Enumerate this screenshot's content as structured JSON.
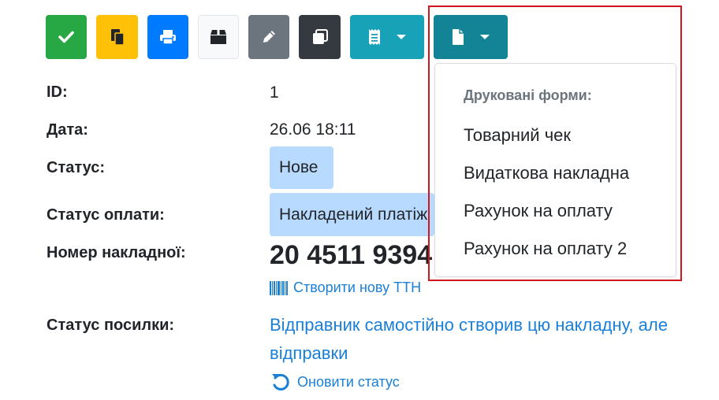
{
  "toolbar": {
    "buttons": [
      {
        "name": "confirm",
        "icon": "check-icon",
        "color": "#28a745"
      },
      {
        "name": "copy",
        "icon": "copy-icon",
        "color": "#ffc107"
      },
      {
        "name": "print",
        "icon": "print-icon",
        "color": "#007bff"
      },
      {
        "name": "package",
        "icon": "box-icon",
        "color": "#f8f9fa"
      },
      {
        "name": "edit",
        "icon": "pencil-icon",
        "color": "#6c757d"
      },
      {
        "name": "duplicate",
        "icon": "clone-icon",
        "color": "#343a40"
      },
      {
        "name": "receipt-dropdown",
        "icon": "receipt-icon",
        "color": "#17a2b8"
      },
      {
        "name": "print-forms-dropdown",
        "icon": "file-icon",
        "color": "#138496"
      }
    ]
  },
  "details": {
    "id_label": "ID:",
    "id_value": "1",
    "date_label": "Дата:",
    "date_value": "26.06 18:11",
    "status_label": "Статус:",
    "status_value": "Нове",
    "payment_status_label": "Статус оплати:",
    "payment_status_value": "Накладений платіж",
    "waybill_label": "Номер накладної:",
    "waybill_value": "20 4511 9394",
    "create_ttn_link": "Створити нову ТТН",
    "parcel_status_label": "Статус посилки:",
    "parcel_status_line1": "Відправник самостійно створив цю накладну, але",
    "parcel_status_line2": "відправки",
    "refresh_status_link": "Оновити статус"
  },
  "dropdown": {
    "header": "Друковані форми:",
    "items": [
      "Товарний чек",
      "Видаткова накладна",
      "Рахунок на оплату",
      "Рахунок на оплату 2"
    ]
  },
  "colors": {
    "link": "#1a7fd6",
    "badge": "#b8daff",
    "highlight": "#d0161a"
  }
}
